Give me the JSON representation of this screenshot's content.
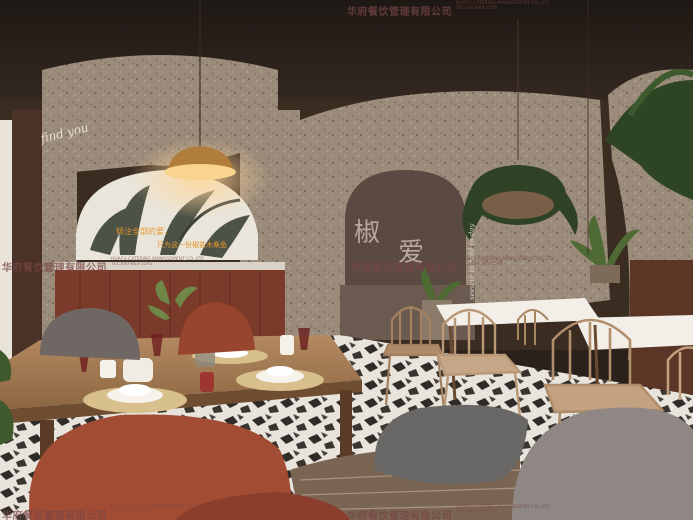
{
  "scene": {
    "neon_script": "find you",
    "wall_sign_line1": "倾注全部的爱，",
    "wall_sign_line2": "只为这一份椒盐木桑鱼",
    "arch_sign_left": "椒",
    "arch_sign_right": "爱",
    "vertical_script": "seeu in to hold to day",
    "colors": {
      "ceiling": "#2b211b",
      "terrazzo_wall": "#9a8a79",
      "arch_panel": "#5a4a42",
      "wood_floor_table": "#a67c55",
      "terracotta_chair": "#a9523a",
      "neon_text": "#e2962a"
    }
  },
  "watermark": {
    "company": "华府餐饮管理有限公司",
    "english": "HUAFU CATERING MANAGEMENT CO.,LTD",
    "phone": "TEL:400-863-5595"
  }
}
